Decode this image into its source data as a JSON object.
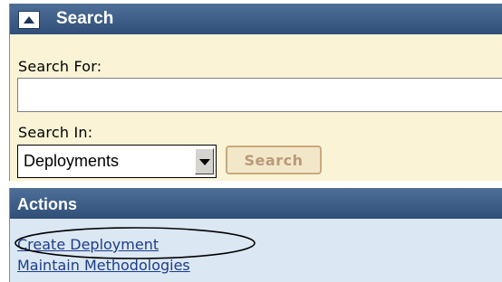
{
  "search_panel": {
    "title": "Search",
    "search_for_label": "Search For:",
    "search_for_value": "",
    "search_in_label": "Search In:",
    "search_in_selected": "Deployments",
    "search_button_label": "Search"
  },
  "actions_panel": {
    "title": "Actions",
    "links": [
      {
        "label": "Create Deployment"
      },
      {
        "label": "Maintain Methodologies"
      }
    ]
  },
  "colors": {
    "header_bg": "#3a5a82",
    "search_panel_bg": "#fbf3d6",
    "actions_panel_bg": "#dbe7f3",
    "link": "#1c3d8a"
  }
}
